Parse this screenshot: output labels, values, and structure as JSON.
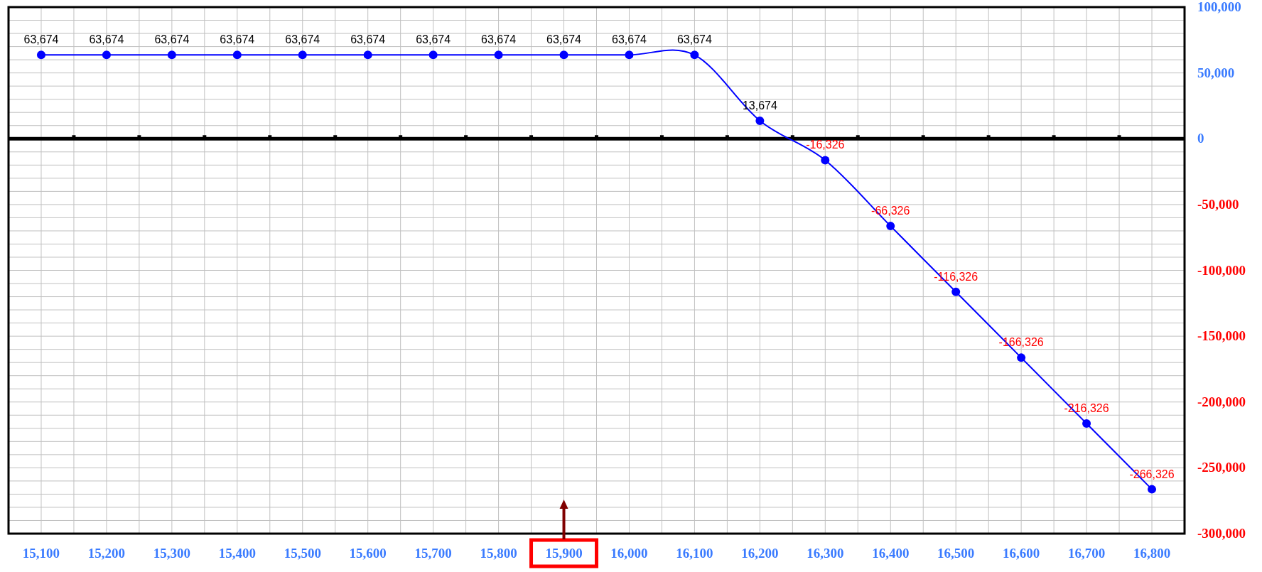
{
  "chart": {
    "chart_data": {
      "type": "line",
      "grid": true,
      "x": [
        15100,
        15200,
        15300,
        15400,
        15500,
        15600,
        15700,
        15800,
        15900,
        16000,
        16100,
        16200,
        16300,
        16400,
        16500,
        16600,
        16700,
        16800
      ],
      "series": [
        {
          "color": "#0000ff",
          "marker": "circle",
          "values": [
            63674,
            63674,
            63674,
            63674,
            63674,
            63674,
            63674,
            63674,
            63674,
            63674,
            63674,
            13674,
            -16326,
            -66326,
            -116326,
            -166326,
            -216326,
            -266326
          ]
        }
      ],
      "value_labels": [
        "63,674",
        "63,674",
        "63,674",
        "63,674",
        "63,674",
        "63,674",
        "63,674",
        "63,674",
        "63,674",
        "63,674",
        "63,674",
        "13,674",
        "-16,326",
        "-66,326",
        "-116,326",
        "-166,326",
        "-216,326",
        "-266,326"
      ],
      "xlim": [
        15050,
        16850
      ],
      "ylim": [
        -300000,
        100000
      ],
      "xticks": [
        {
          "value": 15100,
          "label": "15,100"
        },
        {
          "value": 15200,
          "label": "15,200"
        },
        {
          "value": 15300,
          "label": "15,300"
        },
        {
          "value": 15400,
          "label": "15,400"
        },
        {
          "value": 15500,
          "label": "15,500"
        },
        {
          "value": 15600,
          "label": "15,600"
        },
        {
          "value": 15700,
          "label": "15,700"
        },
        {
          "value": 15800,
          "label": "15,800"
        },
        {
          "value": 15900,
          "label": "15,900"
        },
        {
          "value": 16000,
          "label": "16,000"
        },
        {
          "value": 16100,
          "label": "16,100"
        },
        {
          "value": 16200,
          "label": "16,200"
        },
        {
          "value": 16300,
          "label": "16,300"
        },
        {
          "value": 16400,
          "label": "16,400"
        },
        {
          "value": 16500,
          "label": "16,500"
        },
        {
          "value": 16600,
          "label": "16,600"
        },
        {
          "value": 16700,
          "label": "16,700"
        },
        {
          "value": 16800,
          "label": "16,800"
        }
      ],
      "yticks": [
        {
          "value": 100000,
          "label": "100,000"
        },
        {
          "value": 50000,
          "label": "50,000"
        },
        {
          "value": 0,
          "label": "0"
        },
        {
          "value": -50000,
          "label": "-50,000"
        },
        {
          "value": -100000,
          "label": "-100,000"
        },
        {
          "value": -150000,
          "label": "-150,000"
        },
        {
          "value": -200000,
          "label": "-200,000"
        },
        {
          "value": -250000,
          "label": "-250,000"
        },
        {
          "value": -300000,
          "label": "-300,000"
        }
      ]
    },
    "x_label_marks": [
      {
        "highlighted": false
      },
      {
        "highlighted": false
      },
      {
        "highlighted": false
      },
      {
        "highlighted": false
      },
      {
        "highlighted": false
      },
      {
        "highlighted": false
      },
      {
        "highlighted": false
      },
      {
        "highlighted": false
      },
      {
        "highlighted": true
      },
      {
        "highlighted": false
      },
      {
        "highlighted": false
      },
      {
        "highlighted": false
      },
      {
        "highlighted": false
      },
      {
        "highlighted": false
      },
      {
        "highlighted": false
      },
      {
        "highlighted": false
      },
      {
        "highlighted": false
      },
      {
        "highlighted": false
      }
    ]
  }
}
